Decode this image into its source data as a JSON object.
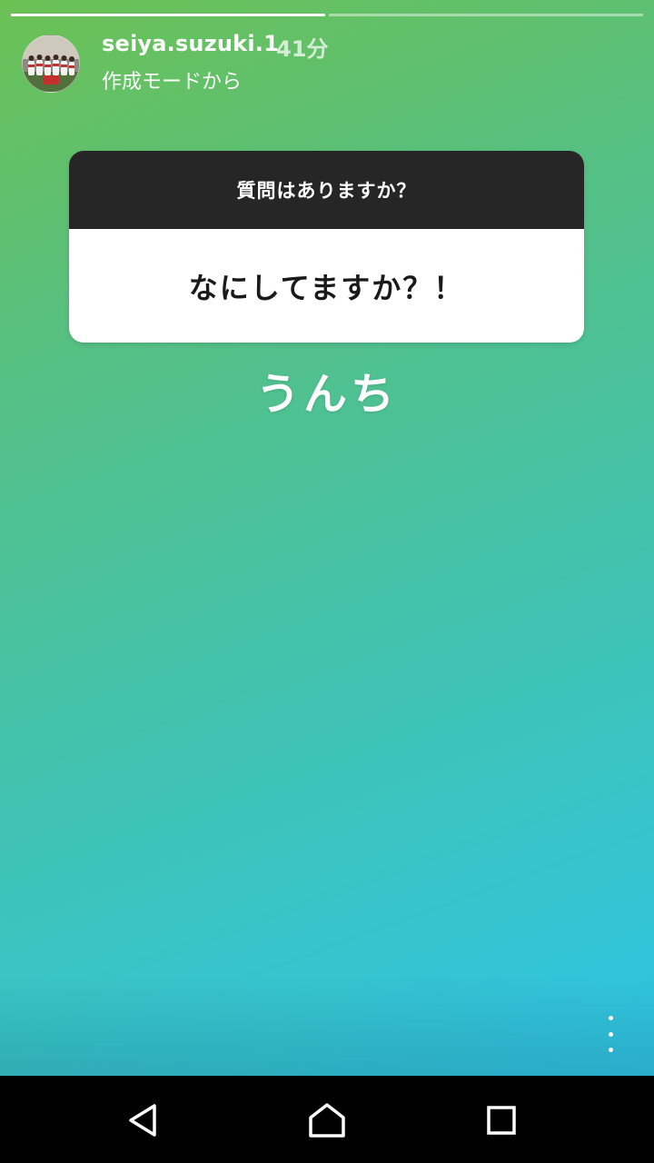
{
  "story": {
    "progress_segments": [
      {
        "state": "done"
      },
      {
        "state": "pending"
      }
    ],
    "username": "seiya.suzuki.1",
    "time": "41分",
    "subtitle": "作成モードから",
    "question_card": {
      "header": "質問はありますか？",
      "question": "なにしてますか？！"
    },
    "answer": "うんち",
    "menu_icon": "more-vertical-icon"
  },
  "navbar": {
    "back_icon": "back-triangle-icon",
    "home_icon": "home-icon",
    "recents_icon": "recents-square-icon"
  },
  "colors": {
    "gradient_top": "#6cc154",
    "gradient_bottom": "#2ec3e6",
    "card_header": "#262626",
    "card_body": "#ffffff"
  }
}
